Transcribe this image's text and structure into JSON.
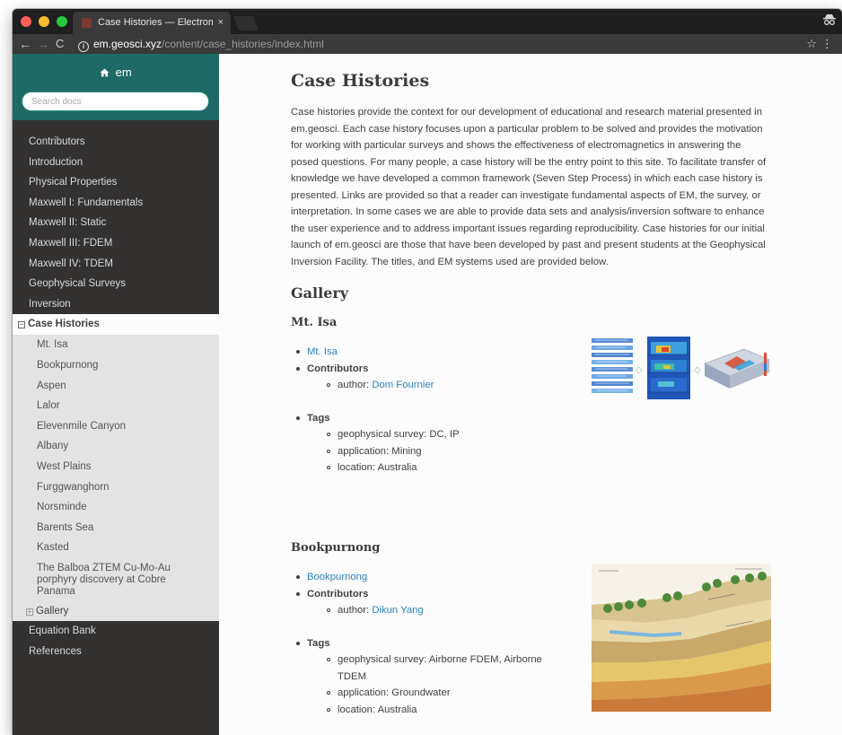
{
  "browser": {
    "tab_title": "Case Histories — Electromagn",
    "tab_close": "×",
    "url_host": "em.geosci.xyz",
    "url_path": "/content/case_histories/index.html"
  },
  "sidebar": {
    "brand": "em",
    "search_placeholder": "Search docs",
    "items_top": [
      "Contributors",
      "Introduction",
      "Physical Properties",
      "Maxwell I: Fundamentals",
      "Maxwell II: Static",
      "Maxwell III: FDEM",
      "Maxwell IV: TDEM",
      "Geophysical Surveys",
      "Inversion"
    ],
    "current": "Case Histories",
    "sub_items": [
      "Mt. Isa",
      "Bookpurnong",
      "Aspen",
      "Lalor",
      "Elevenmile Canyon",
      "Albany",
      "West Plains",
      "Furggwanghorn",
      "Norsminde",
      "Barents Sea",
      "Kasted",
      "The Balboa ZTEM Cu-Mo-Au porphyry discovery at Cobre Panama"
    ],
    "gallery": "Gallery",
    "items_bottom": [
      "Equation Bank",
      "References"
    ]
  },
  "main": {
    "title": "Case Histories",
    "intro": "Case histories provide the context for our development of educational and research material presented in em.geosci. Each case history focuses upon a particular problem to be solved and provides the motivation for working with particular surveys and shows the effectiveness of electromagnetics in answering the posed questions. For many people, a case history will be the entry point to this site. To facilitate transfer of knowledge we have developed a common framework (Seven Step Process) in which each case history is presented. Links are provided so that a reader can investigate fundamental aspects of EM, the survey, or interpretation. In some cases we are able to provide data sets and analysis/inversion software to enhance the user experience and to address important issues regarding reproducibility. Case histories for our initial launch of em.geosci are those that have been developed by past and present students at the Geophysical Inversion Facility. The titles, and EM systems used are provided below.",
    "gallery_heading": "Gallery",
    "cases": [
      {
        "heading": "Mt. Isa",
        "link": "Mt. Isa",
        "contributors_label": "Contributors",
        "author_label": "author: ",
        "author": "Dom Fournier",
        "tags_label": "Tags",
        "tags": [
          "geophysical survey: DC, IP",
          "application: Mining",
          "location: Australia"
        ]
      },
      {
        "heading": "Bookpurnong",
        "link": "Bookpurnong",
        "contributors_label": "Contributors",
        "author_label": "author: ",
        "author": "Dikun Yang",
        "tags_label": "Tags",
        "tags": [
          "geophysical survey: Airborne FDEM, Airborne TDEM",
          "application: Groundwater",
          "location: Australia"
        ]
      }
    ]
  }
}
